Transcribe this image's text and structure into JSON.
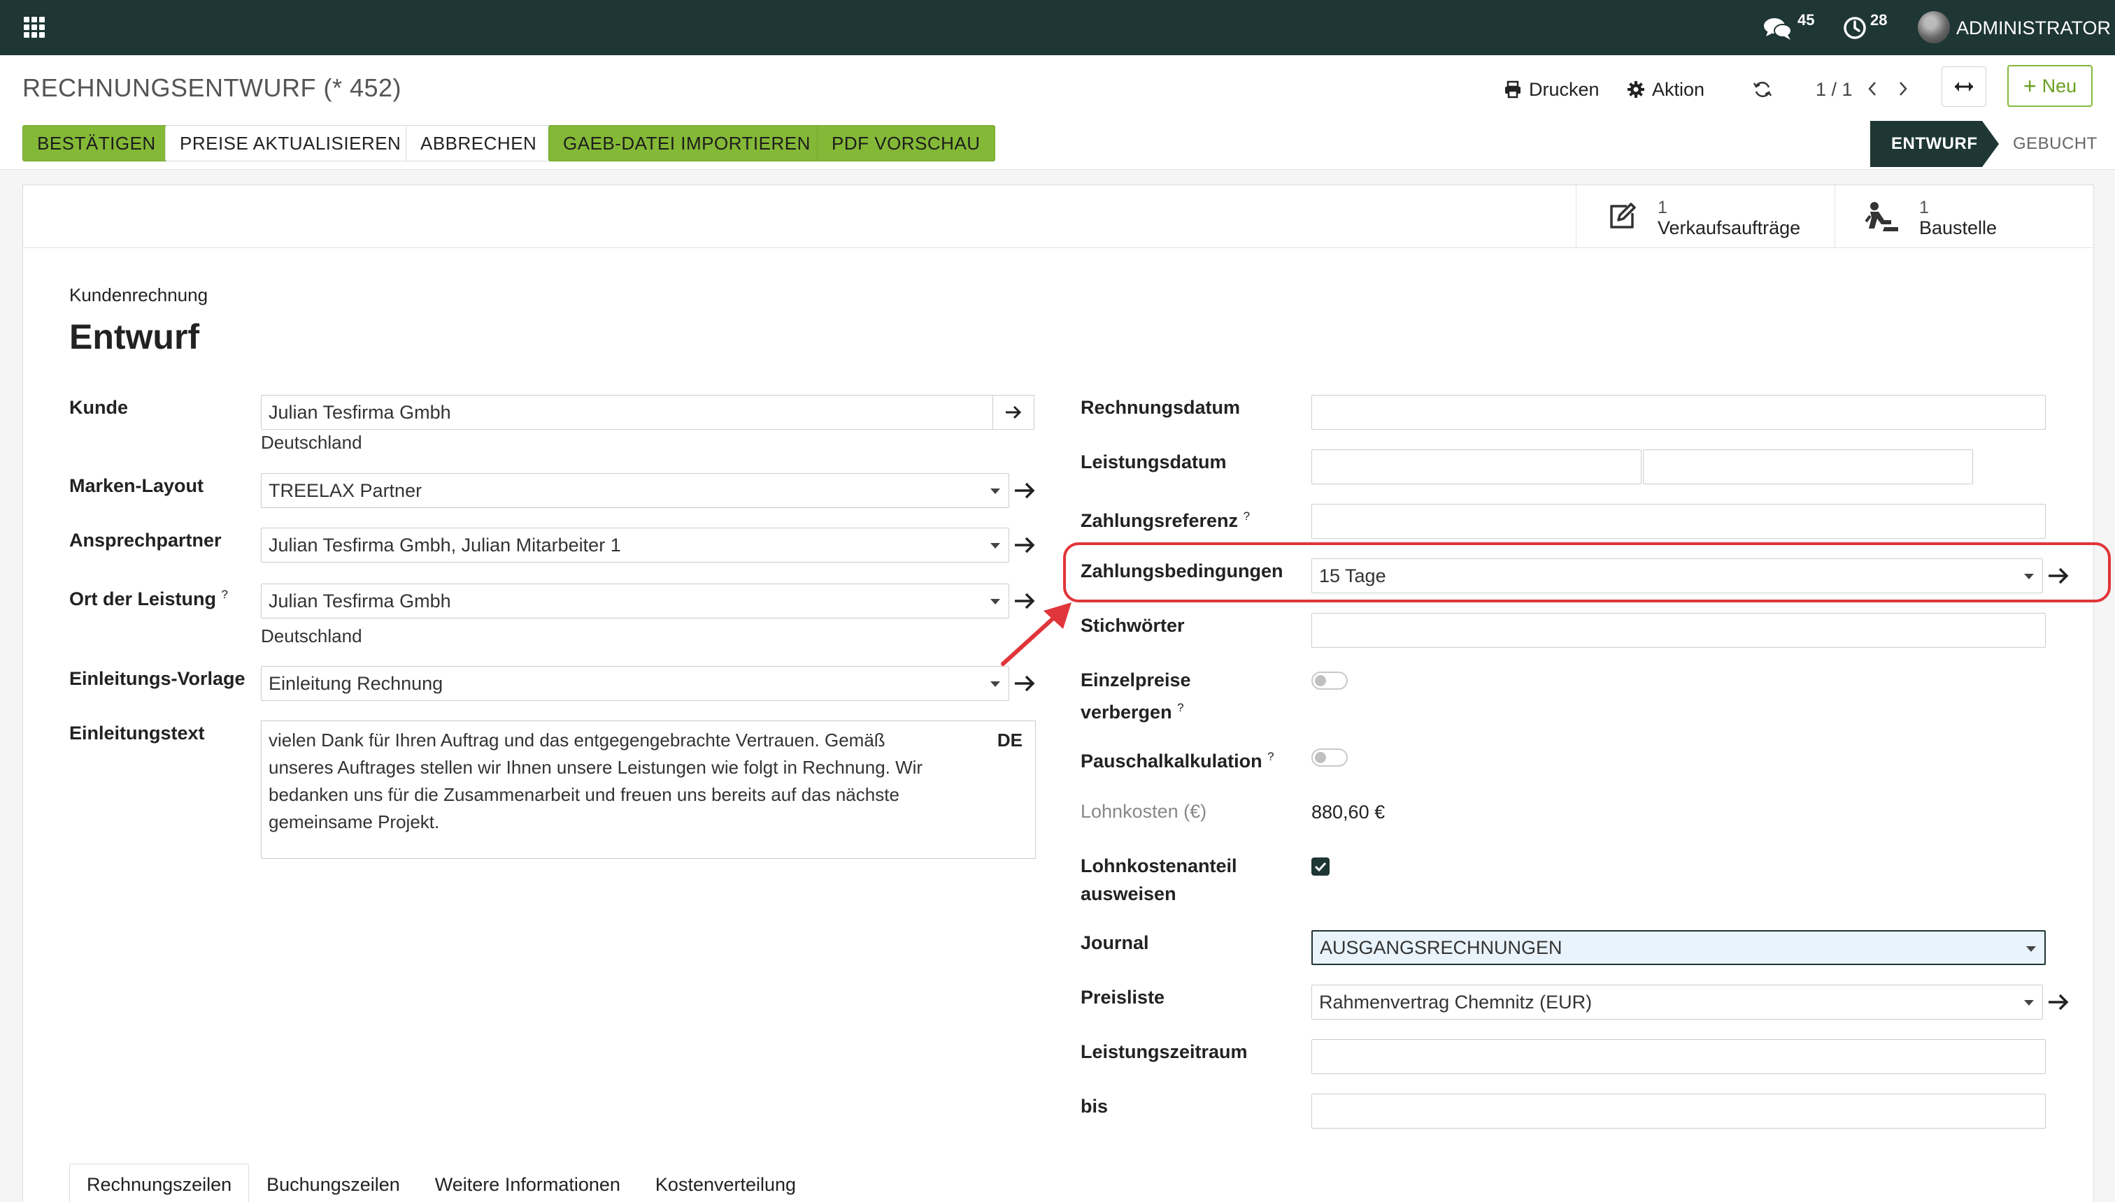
{
  "navbar": {
    "apps_icon": "grid-icon",
    "messages_count": "45",
    "activities_count": "28",
    "user_name": "ADMINISTRATOR"
  },
  "control_panel": {
    "title": "RECHNUNGSENTWURF (* 452)",
    "print_label": "Drucken",
    "action_label": "Aktion",
    "pager": "1 / 1",
    "new_label": "Neu",
    "actions": [
      "BESTÄTIGEN",
      "PREISE AKTUALISIEREN",
      "ABBRECHEN",
      "GAEB-DATEI IMPORTIEREN",
      "PDF VORSCHAU"
    ],
    "status": {
      "current": "ENTWURF",
      "next": "GEBUCHT"
    }
  },
  "smart_buttons": [
    {
      "count": "1",
      "label": "Verkaufsaufträge",
      "icon": "edit-icon"
    },
    {
      "count": "1",
      "label": "Baustelle",
      "icon": "construction-worker-icon"
    }
  ],
  "document": {
    "type": "Kundenrechnung",
    "name": "Entwurf"
  },
  "left_fields": {
    "kunde": {
      "label": "Kunde",
      "value": "Julian Tesfirma Gmbh",
      "sub": "Deutschland"
    },
    "marken_layout": {
      "label": "Marken-Layout",
      "value": "TREELAX Partner"
    },
    "ansprechpartner": {
      "label": "Ansprechpartner",
      "value": "Julian Tesfirma Gmbh, Julian Mitarbeiter 1"
    },
    "ort": {
      "label": "Ort der Leistung",
      "help": "?",
      "value": "Julian Tesfirma Gmbh",
      "sub": "Deutschland"
    },
    "vorlage": {
      "label": "Einleitungs-Vorlage",
      "value": "Einleitung Rechnung"
    },
    "text": {
      "label": "Einleitungstext",
      "lang": "DE",
      "lines": [
        "vielen Dank für Ihren Auftrag und das entgegengebrachte Vertrauen. Gemäß",
        "unseres Auftrages stellen wir Ihnen unsere Leistungen wie folgt in Rechnung. Wir",
        "bedanken uns für die Zusammenarbeit und freuen uns bereits auf das nächste",
        "gemeinsame Projekt."
      ]
    }
  },
  "right_fields": {
    "rechnungsdatum": {
      "label": "Rechnungsdatum",
      "value": ""
    },
    "leistungsdatum": {
      "label": "Leistungsdatum",
      "value_from": "",
      "value_to": ""
    },
    "zahlungsreferenz": {
      "label": "Zahlungsreferenz",
      "help": "?",
      "value": ""
    },
    "zahlungsbedingungen": {
      "label": "Zahlungsbedingungen",
      "value": "15 Tage"
    },
    "stichwoerter": {
      "label": "Stichwörter",
      "value": ""
    },
    "einzelpreise": {
      "label_line1": "Einzelpreise",
      "label_line2": "verbergen",
      "help": "?",
      "checked": false
    },
    "pauschal": {
      "label": "Pauschalkalkulation",
      "help": "?",
      "checked": false
    },
    "lohnkosten": {
      "label": "Lohnkosten (€)",
      "value": "880,60 €"
    },
    "lohnanteil": {
      "label_line1": "Lohnkostenanteil",
      "label_line2": "ausweisen",
      "checked": true
    },
    "journal": {
      "label": "Journal",
      "value": "AUSGANGSRECHNUNGEN"
    },
    "preisliste": {
      "label": "Preisliste",
      "value": "Rahmenvertrag Chemnitz (EUR)"
    },
    "zeitraum": {
      "label": "Leistungszeitraum",
      "value": ""
    },
    "bis": {
      "label": "bis",
      "value": ""
    }
  },
  "tabs": [
    "Rechnungszeilen",
    "Buchungszeilen",
    "Weitere Informationen",
    "Kostenverteilung"
  ],
  "annotation_color": "#e0353a"
}
